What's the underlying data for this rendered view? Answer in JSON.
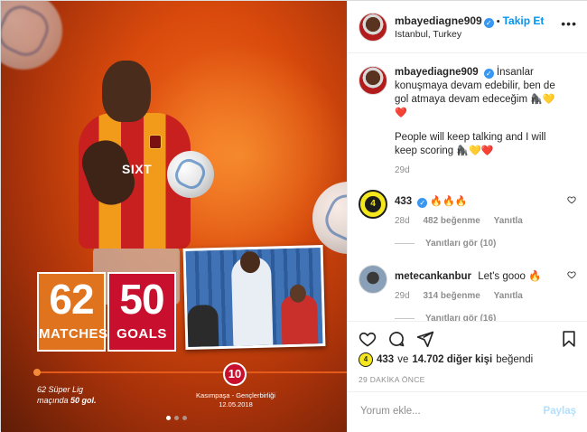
{
  "post_image": {
    "stats": [
      {
        "number": "62",
        "label": "MATCHES"
      },
      {
        "number": "50",
        "label": "GOALS"
      }
    ],
    "sponsor": "SIXT",
    "caption_left_line1": "62 Süper Lig",
    "caption_left_line2_prefix": "maçında ",
    "caption_left_line2_bold": "50 gol.",
    "goal_badge": "10",
    "caption_match": "Kasımpaşa - Gençlerbirliği",
    "caption_date": "12.05.2018",
    "carousel_dots": 3,
    "carousel_active": 0,
    "colors": {
      "matches": "#e0731e",
      "goals": "#c8102e"
    }
  },
  "header": {
    "username": "mbayediagne909",
    "separator": "•",
    "follow_label": "Takip Et",
    "location": "Istanbul, Turkey",
    "more_icon": "ellipsis-icon"
  },
  "caption": {
    "username": "mbayediagne909",
    "text_tr": "İnsanlar konuşmaya devam edebilir, ben de gol atmaya devam edeceğim",
    "emoji_tr": "🦍💛❤️",
    "text_en": "People will keep talking and I will keep scoring",
    "emoji_en": "🦍💛❤️",
    "age": "29d"
  },
  "comments": [
    {
      "username": "433",
      "avatar_text": "4",
      "text": "🔥🔥🔥",
      "age": "28d",
      "likes": "482 beğenme",
      "reply": "Yanıtla",
      "view_replies": "Yanıtları gör (10)"
    },
    {
      "username": "metecankanbur",
      "text": "Let's gooo 🔥",
      "age": "29d",
      "likes": "314 beğenme",
      "reply": "Yanıtla",
      "view_replies": "Yanıtları gör (16)"
    }
  ],
  "actions": {
    "icons": [
      "heart-icon",
      "comment-icon",
      "share-icon",
      "bookmark-icon"
    ]
  },
  "likes_summary": {
    "avatar_text": "4",
    "first_liker": "433",
    "middle": "ve",
    "others": "14.702 diğer kişi",
    "suffix": "beğendi"
  },
  "time_ago": "29 DAKİKA ÖNCE",
  "comment_box": {
    "placeholder": "Yorum ekle...",
    "post_label": "Paylaş"
  },
  "verified_mark": "✓"
}
